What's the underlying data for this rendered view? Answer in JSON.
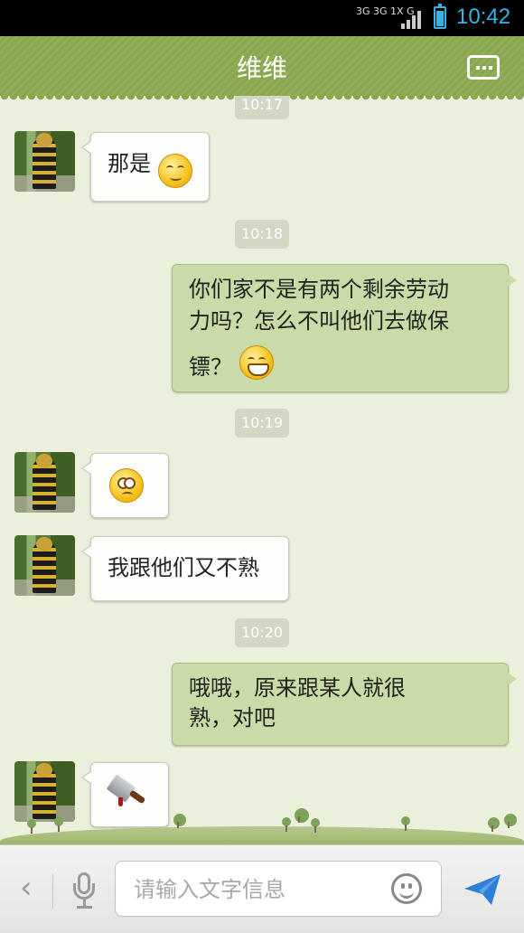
{
  "status_bar": {
    "network": "3G 3G 1X G",
    "time": "10:42"
  },
  "header": {
    "title": "维维",
    "more_icon": "more-icon"
  },
  "chat": {
    "timestamps": [
      "10:17",
      "10:18",
      "10:19",
      "10:20"
    ],
    "messages": [
      {
        "side": "in",
        "text": "那是",
        "emoji": "shy-smile-emoji"
      },
      {
        "side": "out",
        "text": "你们家不是有两个剩余劳动力吗？怎么不叫他们去做保镖？",
        "emoji": "grin-emoji"
      },
      {
        "side": "in",
        "emoji": "confused-emoji"
      },
      {
        "side": "in",
        "text": "我跟他们又不熟"
      },
      {
        "side": "out",
        "text": "哦哦，原来跟某人就很熟，对吧"
      },
      {
        "side": "in",
        "emoji": "cleaver-emoji"
      }
    ],
    "lines": {
      "m2_l1": "你们家不是有两个剩余劳动",
      "m2_l2": "力吗？怎么不叫他们去做保",
      "m2_l3": "镖？",
      "m5_l1": "哦哦，原来跟某人就很",
      "m5_l2": "熟，对吧"
    }
  },
  "input_bar": {
    "back_label": "‹",
    "placeholder": "请输入文字信息",
    "value": ""
  },
  "colors": {
    "accent": "#33b5e5",
    "header": "#8fae57",
    "out_bubble": "#c9dba6",
    "send": "#2b7fd6"
  }
}
